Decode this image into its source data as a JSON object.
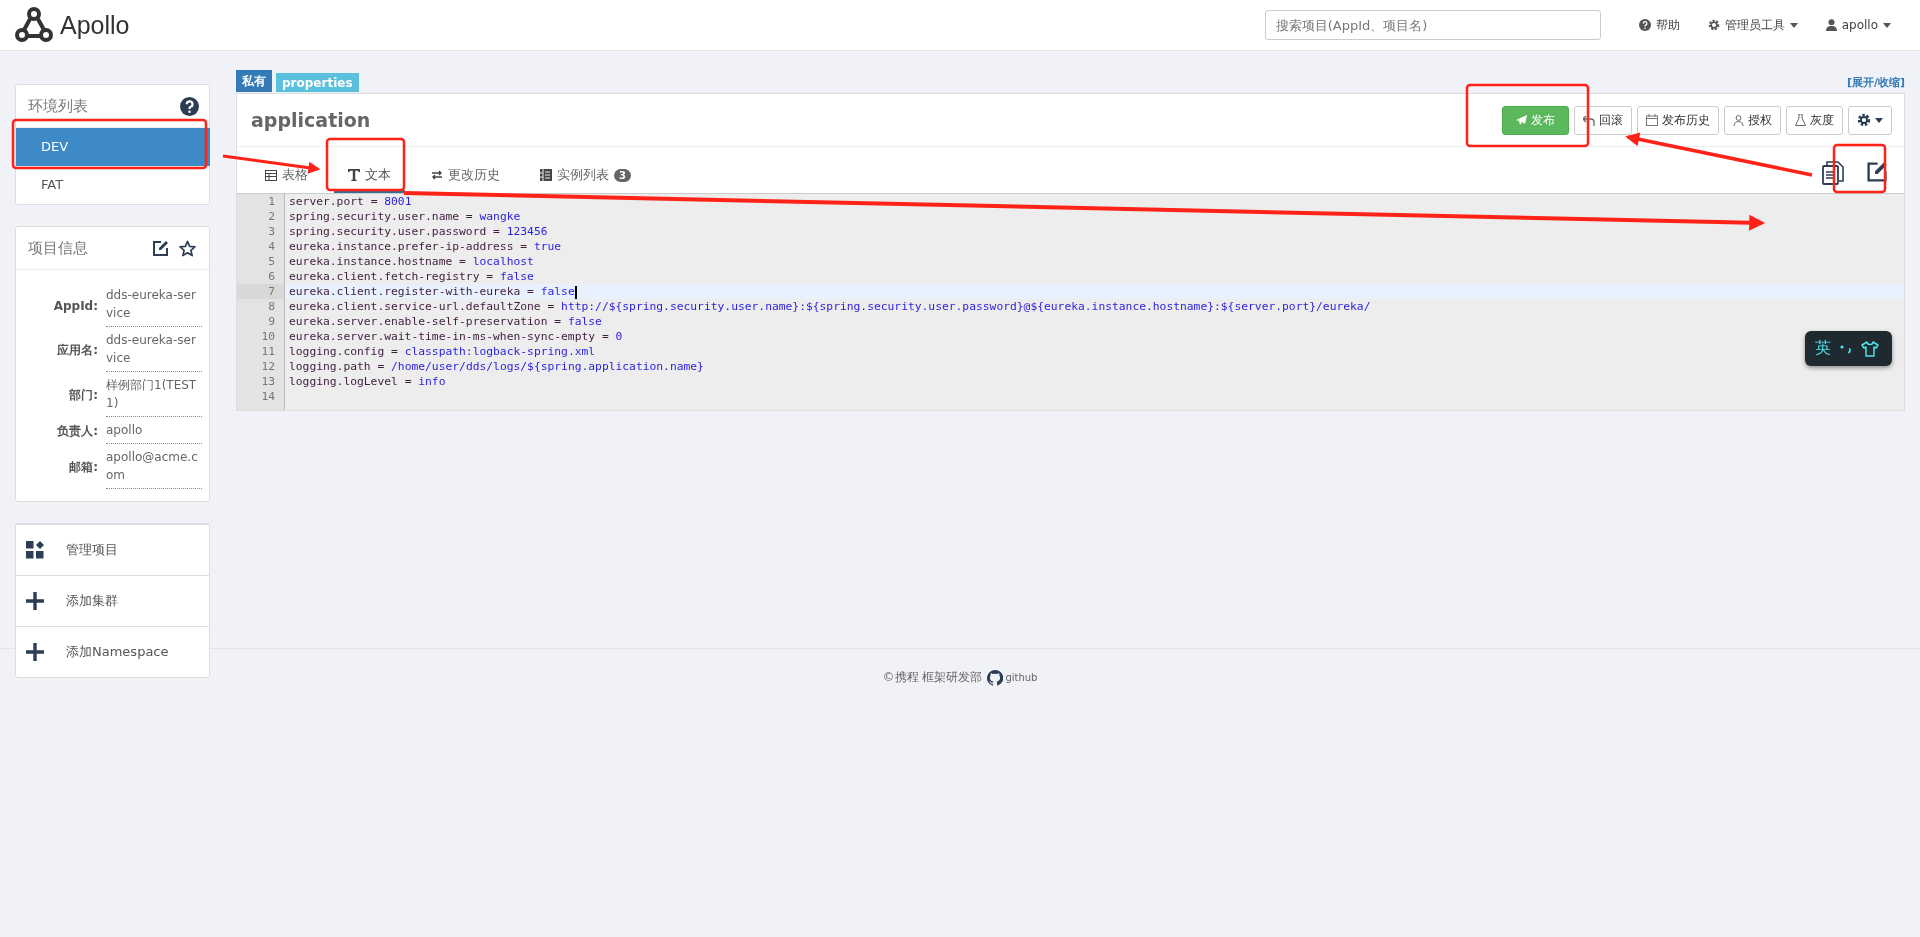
{
  "header": {
    "brand": "Apollo",
    "search": {
      "placeholder": "搜索项目(AppId、项目名)"
    },
    "nav": [
      {
        "label": "帮助",
        "kind": "help",
        "dropdown": false
      },
      {
        "label": "管理员工具",
        "kind": "admin",
        "dropdown": true
      },
      {
        "label": "apollo",
        "kind": "user",
        "dropdown": true
      }
    ]
  },
  "environments": {
    "title": "环境列表",
    "items": [
      {
        "label": "DEV",
        "selected": true
      },
      {
        "label": "FAT",
        "selected": false
      }
    ]
  },
  "project_info": {
    "title": "项目信息",
    "fields": [
      {
        "label": "AppId:",
        "value": "dds-eureka-service"
      },
      {
        "label": "应用名:",
        "value": "dds-eureka-service"
      },
      {
        "label": "部门:",
        "value": "样例部门1(TEST1)"
      },
      {
        "label": "负责人:",
        "value": "apollo"
      },
      {
        "label": "邮箱:",
        "value": "apollo@acme.com"
      }
    ]
  },
  "actions": [
    {
      "label": "管理项目",
      "kind": "manage"
    },
    {
      "label": "添加集群",
      "kind": "add"
    },
    {
      "label": "添加Namespace",
      "kind": "add"
    }
  ],
  "namespace": {
    "tags": [
      {
        "label": "私有",
        "kind": "scope"
      },
      {
        "label": "properties",
        "kind": "format"
      }
    ],
    "toggle": "[展开/收缩]",
    "name": "application",
    "buttons": [
      {
        "label": "发布",
        "kind": "publish"
      },
      {
        "label": "回滚",
        "kind": "rollback"
      },
      {
        "label": "发布历史",
        "kind": "history"
      },
      {
        "label": "授权",
        "kind": "auth"
      },
      {
        "label": "灰度",
        "kind": "gray"
      },
      {
        "kind": "settings"
      }
    ],
    "tabs": [
      {
        "label": "表格",
        "kind": "table",
        "selected": false
      },
      {
        "label": "文本",
        "kind": "text",
        "selected": true
      },
      {
        "label": "更改历史",
        "kind": "history",
        "selected": false
      },
      {
        "label": "实例列表",
        "kind": "instances",
        "selected": false,
        "badge": "3"
      }
    ],
    "tools": [
      {
        "kind": "copy"
      },
      {
        "kind": "edit"
      }
    ],
    "editor": {
      "lines": [
        {
          "number": "1",
          "key": "server.port",
          "operator": "=",
          "value": "8001",
          "active": false
        },
        {
          "number": "2",
          "key": "spring.security.user.name",
          "operator": "=",
          "value": "wangke",
          "active": false
        },
        {
          "number": "3",
          "key": "spring.security.user.password",
          "operator": "=",
          "value": "123456",
          "active": false
        },
        {
          "number": "4",
          "key": "eureka.instance.prefer-ip-address",
          "operator": "=",
          "value": "true",
          "active": false
        },
        {
          "number": "5",
          "key": "eureka.instance.hostname",
          "operator": "=",
          "value": "localhost",
          "active": false
        },
        {
          "number": "6",
          "key": "eureka.client.fetch-registry",
          "operator": "=",
          "value": "false",
          "active": false
        },
        {
          "number": "7",
          "key": "eureka.client.register-with-eureka",
          "operator": "=",
          "value": "false",
          "active": true
        },
        {
          "number": "8",
          "key": "eureka.client.service-url.defaultZone",
          "operator": "=",
          "value": "http://${spring.security.user.name}:${spring.security.user.password}@${eureka.instance.hostname}:${server.port}/eureka/",
          "active": false
        },
        {
          "number": "9",
          "key": "eureka.server.enable-self-preservation",
          "operator": "=",
          "value": "false",
          "active": false
        },
        {
          "number": "10",
          "key": "eureka.server.wait-time-in-ms-when-sync-empty",
          "operator": "=",
          "value": "0",
          "active": false
        },
        {
          "number": "11",
          "key": "logging.config",
          "operator": "=",
          "value": "classpath:logback-spring.xml",
          "active": false
        },
        {
          "number": "12",
          "key": "logging.path",
          "operator": "=",
          "value": "/home/user/dds/logs/${spring.application.name}",
          "active": false
        },
        {
          "number": "13",
          "key": "logging.logLevel",
          "operator": "=",
          "value": "info",
          "active": false
        },
        {
          "number": "14",
          "active": false
        }
      ]
    }
  },
  "footer": {
    "text": "©携程 框架研发部",
    "link": "github"
  },
  "ime": {
    "label": "英"
  }
}
